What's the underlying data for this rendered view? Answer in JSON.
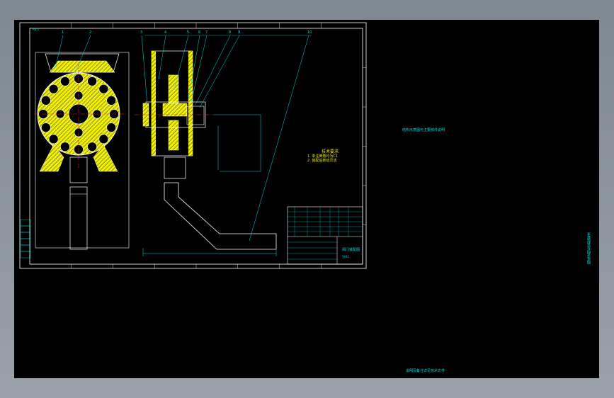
{
  "colors": {
    "background": "#000000",
    "frame": "#8c939c",
    "drawing_line": "#ffffff",
    "dimension_line": "#00e0e0",
    "section_fill": "#f0f000",
    "center_line": "#ff2020",
    "text_green": "#00ff66"
  },
  "drawing": {
    "corner_code": "A0-1",
    "notes_title": "技术要求",
    "notes_line1": "1. 未注倒角均为C1",
    "notes_line2": "2. 装配后转动灵活",
    "title_block_name": "阀门装配图",
    "title_block_code": "YJ-01"
  },
  "sheet_labels": {
    "right_upper": "结构示意图与主要部件说明",
    "right_bottom": "说明及备注详见技术文件",
    "right_vertical": "图纸说明及装配要求"
  },
  "part_numbers": [
    "1",
    "2",
    "3",
    "4",
    "5",
    "6",
    "7",
    "8",
    "9",
    "10"
  ]
}
